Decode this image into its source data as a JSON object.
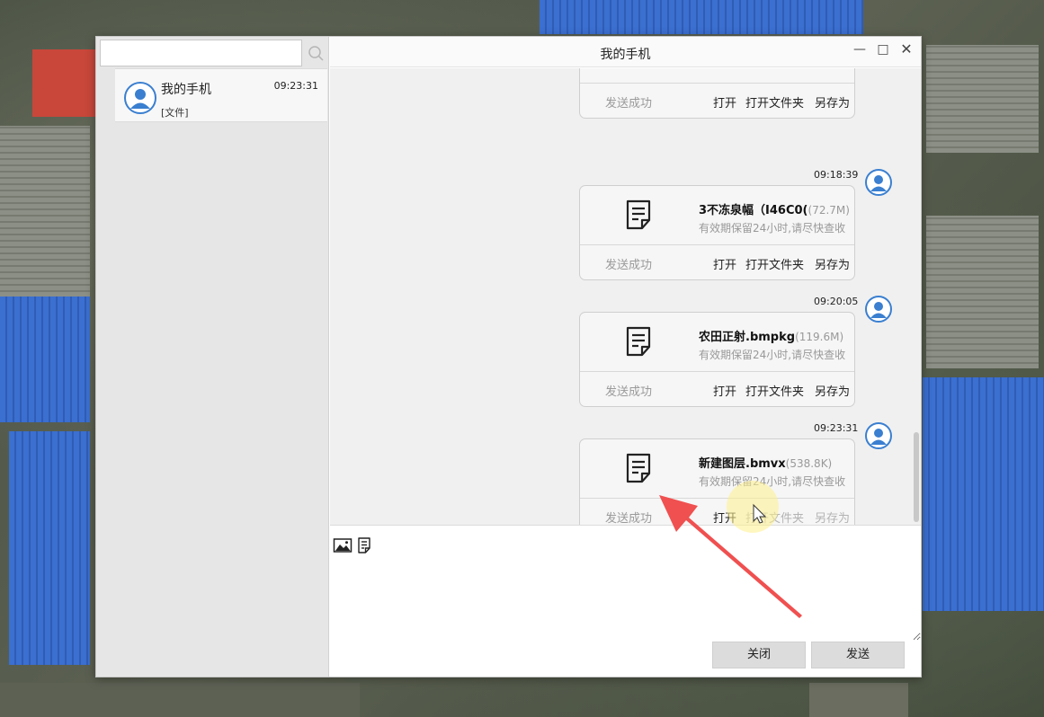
{
  "window": {
    "title": "我的手机"
  },
  "sidebar": {
    "search": {
      "value": "",
      "placeholder": ""
    },
    "contacts": [
      {
        "name": "我的手机",
        "time": "09:23:31",
        "preview": "[文件]"
      }
    ]
  },
  "chat": {
    "messages": [
      {
        "status": "发送成功",
        "actions": {
          "open": "打开",
          "open_folder": "打开文件夹",
          "save_as": "另存为"
        }
      },
      {
        "time": "09:18:39",
        "file_name": "3不冻泉幅（I46C0(",
        "file_size": "(72.7M)",
        "note": "有效期保留24小时,请尽快查收",
        "status": "发送成功",
        "actions": {
          "open": "打开",
          "open_folder": "打开文件夹",
          "save_as": "另存为"
        }
      },
      {
        "time": "09:20:05",
        "file_name": "农田正射.bmpkg",
        "file_size": "(119.6M)",
        "note": "有效期保留24小时,请尽快查收",
        "status": "发送成功",
        "actions": {
          "open": "打开",
          "open_folder": "打开文件夹",
          "save_as": "另存为"
        }
      },
      {
        "time": "09:23:31",
        "file_name": "新建图层.bmvx",
        "file_size": "(538.8K)",
        "note": "有效期保留24小时,请尽快查收",
        "status": "发送成功",
        "actions": {
          "open": "打开",
          "open_folder": "打开文件夹",
          "save_as": "另存为"
        }
      }
    ]
  },
  "footer": {
    "close_label": "关闭",
    "send_label": "发送"
  },
  "colors": {
    "avatar": "#3a7fd0",
    "annotation_arrow": "#f05050",
    "cursor_highlight": "#fff08c"
  }
}
